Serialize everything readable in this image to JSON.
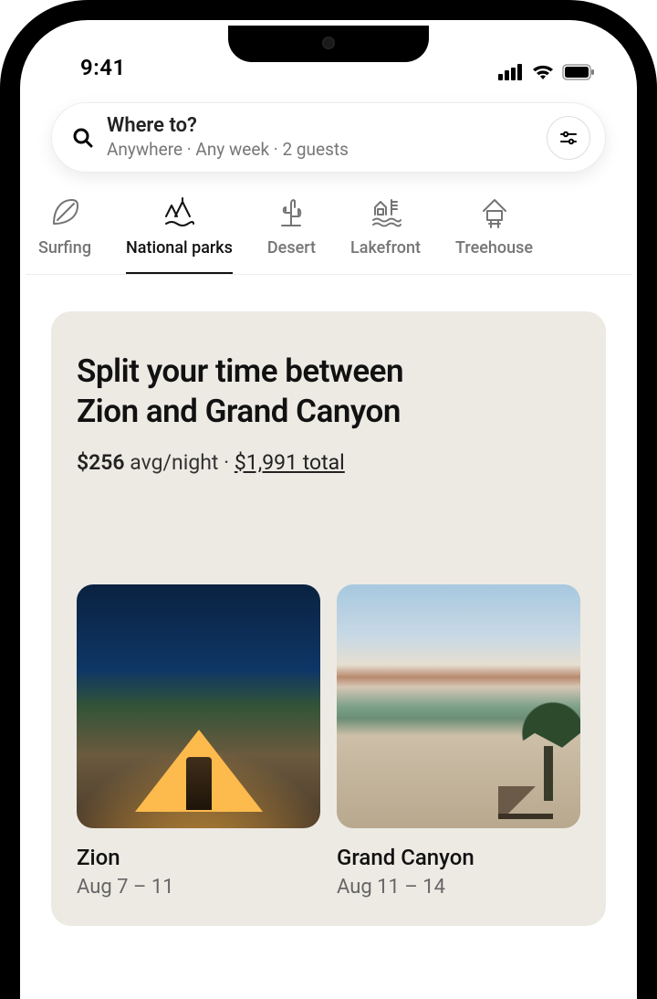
{
  "status": {
    "time": "9:41"
  },
  "search": {
    "title": "Where to?",
    "subtitle": "Anywhere · Any week · 2 guests"
  },
  "categories": [
    {
      "id": "surfing",
      "label": "Surfing",
      "active": false
    },
    {
      "id": "national-parks",
      "label": "National parks",
      "active": true
    },
    {
      "id": "desert",
      "label": "Desert",
      "active": false
    },
    {
      "id": "lakefront",
      "label": "Lakefront",
      "active": false
    },
    {
      "id": "treehouse",
      "label": "Treehouse",
      "active": false
    }
  ],
  "card": {
    "title_line1": "Split your time between",
    "title_line2": "Zion and Grand Canyon",
    "avg_price": "$256",
    "avg_label": "avg/night",
    "sep": " · ",
    "total": "$1,991 total"
  },
  "destinations": [
    {
      "name": "Zion",
      "dates": "Aug 7 – 11"
    },
    {
      "name": "Grand Canyon",
      "dates": "Aug 11 – 14"
    }
  ]
}
